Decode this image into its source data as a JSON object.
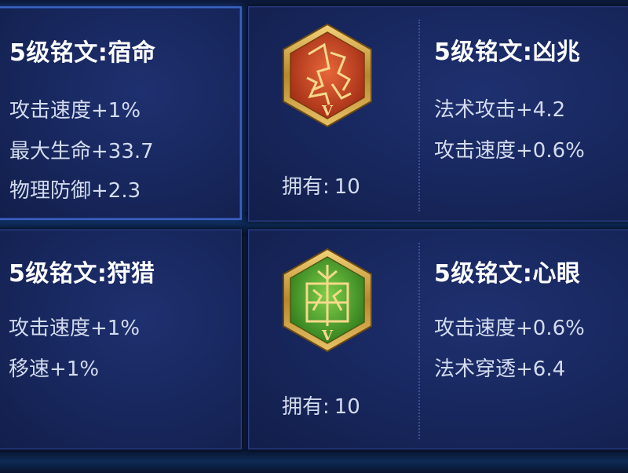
{
  "cards": [
    {
      "title": "5级铭文:宿命",
      "stats": [
        "攻击速度+1%",
        "最大生命+33.7",
        "物理防御+2.3"
      ]
    },
    {
      "title": "5级铭文:凶兆",
      "stats": [
        "法术攻击+4.2",
        "攻击速度+0.6%"
      ],
      "owned_label": "拥有:",
      "owned_count": "10",
      "emblem": {
        "icon": "red-hexagon-rune-icon",
        "grade": "V",
        "color": "#c8401f"
      }
    },
    {
      "title": "5级铭文:狩猎",
      "stats": [
        "攻击速度+1%",
        "移速+1%"
      ]
    },
    {
      "title": "5级铭文:心眼",
      "stats": [
        "攻击速度+0.6%",
        "法术穿透+6.4"
      ],
      "owned_label": "拥有:",
      "owned_count": "10",
      "emblem": {
        "icon": "green-hexagon-rune-icon",
        "grade": "V",
        "color": "#3f9a2a"
      }
    }
  ],
  "colors": {
    "background": "#0c1a3a",
    "card": "#17265c",
    "border_selected": "#3a62c0",
    "title": "#ffffff",
    "stat": "#d3dbee",
    "gold": "#d4a640"
  }
}
